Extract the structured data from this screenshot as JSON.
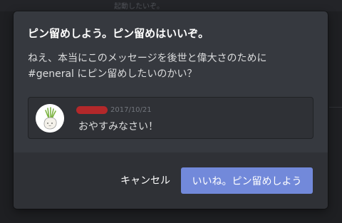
{
  "background": {
    "ghost_text": "起動したいぞ。"
  },
  "dialog": {
    "title": "ピン留めしよう。ピン留めはいいぞ。",
    "body_line1": "ねえ、本当にこのメッセージを後世と偉大さのために",
    "body_line2": "#general にピン留めしたいのかい？",
    "preview": {
      "timestamp": "2017/10/21",
      "message": "おやすみなさい！"
    },
    "cancel_label": "キャンセル",
    "confirm_label": "いいね。ピン留めしよう"
  },
  "colors": {
    "brand": "#7289da",
    "redaction": "#b3282a"
  }
}
